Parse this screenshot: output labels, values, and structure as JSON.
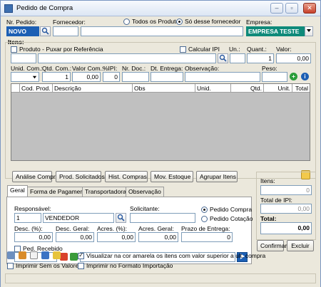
{
  "window": {
    "title": "Pedido de Compra",
    "min_glyph": "–",
    "max_glyph": "▫",
    "close_glyph": "✕"
  },
  "header": {
    "nr_pedido_label": "Nr. Pedido:",
    "nr_pedido_value": "NOVO",
    "fornecedor_label": "Fornecedor:",
    "radio_todos": "Todos os Produtos",
    "radio_so_desse": "Só desse fornecedor",
    "empresa_label": "Empresa:",
    "empresa_value": "EMPRESA TESTE"
  },
  "itens": {
    "section_label": "Itens:",
    "produto_label": "Produto - Puxar por Referência",
    "calcular_ipi": "Calcular IPI",
    "un_label": "Un.:",
    "quant_label": "Quant.:",
    "quant_value": "1",
    "valor_label": "Valor:",
    "valor_value": "0,00",
    "unid_com_label": "Unid. Com.:",
    "qtd_com_label": "Qtd. Com.:",
    "qtd_com_value": "1",
    "valor_com_label": "Valor Com.:",
    "valor_com_value": "0,00",
    "ipi_label": "%IPI:",
    "ipi_value": "0",
    "nr_doc_label": "Nr. Doc.:",
    "dt_entrega_label": "Dt. Entrega:",
    "observacao_label": "Observação:",
    "peso_label": "Peso:"
  },
  "grid": {
    "columns": [
      "Cod. Prod.",
      "Descrição",
      "Obs",
      "Unid.",
      "Qtd.",
      "Unit.",
      "Total"
    ]
  },
  "actions": [
    "Análise Compra",
    "Prod. Solicitados",
    "Hist. Compras",
    "Mov. Estoque",
    "Agrupar Itens"
  ],
  "tabs": [
    "Geral",
    "Forma de Pagamento",
    "Transportadora",
    "Observação"
  ],
  "geral": {
    "responsavel_label": "Responsável:",
    "responsavel_code": "1",
    "responsavel_name": "VENDEDOR",
    "solicitante_label": "Solicitante:",
    "radio_pedido_compra": "Pedido Compra",
    "radio_pedido_cotacao": "Pedido Cotação",
    "desc_pct_label": "Desc. (%):",
    "desc_pct_value": "0,00",
    "desc_geral_label": "Desc. Geral:",
    "desc_geral_value": "0,00",
    "acres_pct_label": "Acres. (%):",
    "acres_pct_value": "0,00",
    "acres_geral_label": "Acres. Geral:",
    "acres_geral_value": "0,00",
    "prazo_label": "Prazo de Entrega:",
    "prazo_value": "0",
    "ped_recebido_label": "Ped. Recebido"
  },
  "totals": {
    "itens_label": "Itens:",
    "itens_value": "0",
    "total_ipi_label": "Total de IPI:",
    "total_ipi_value": "0,00",
    "total_label": "Total:",
    "total_value": "0,00"
  },
  "buttons": {
    "confirmar": "Confirmar",
    "excluir": "Excluir"
  },
  "footer": {
    "visualizar": "Visualizar na cor amarela os itens com valor superior a ult. compra",
    "imprimir_sem_valores": "Imprimir Sem os Valores",
    "imprimir_formato": "Imprimir no Formato Importação"
  },
  "colors": {
    "accent_blue": "#1c5fb4",
    "empresa_teal": "#0f8a7a",
    "window_bg": "#ebe8dc"
  }
}
